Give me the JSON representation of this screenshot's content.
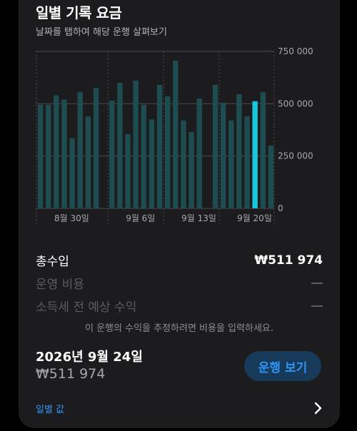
{
  "header": {
    "title": "일별 기록 요금",
    "subtitle": "날짜를 탭하여 해당 운행 살펴보기"
  },
  "chart_data": {
    "type": "bar",
    "ylim": [
      0,
      750000
    ],
    "yticks": [
      0,
      250000,
      500000,
      750000
    ],
    "ytick_labels": [
      "0",
      "250 000",
      "500 000",
      "750 000"
    ],
    "xtick_labels": [
      "8월 30일",
      "9월 6일",
      "9월 13일",
      "9월 20일"
    ],
    "grid": true,
    "selected_index": 27,
    "values": [
      495000,
      495000,
      540000,
      520000,
      335000,
      555000,
      440000,
      575000,
      0,
      515000,
      600000,
      355000,
      610000,
      495000,
      425000,
      590000,
      535000,
      705000,
      420000,
      365000,
      525000,
      0,
      590000,
      505000,
      420000,
      545000,
      440000,
      511974,
      555000,
      300000
    ],
    "colors": {
      "bar": "#1d4d50",
      "selected": "#18c8dc",
      "grid": "#4a4a4e",
      "label": "#a8a8ac"
    }
  },
  "summary": {
    "total_label": "총수입",
    "total_value": "₩511 974",
    "cost_label": "운영 비용",
    "cost_value": "—",
    "net_label": "소득세 전 예상 수익",
    "net_value": "—",
    "hint": "이 운행의 수익을 추정하려면 비용을 입력하세요."
  },
  "selection": {
    "date": "2026년 9월 24일",
    "amount": "₩511 974",
    "view_button": "운행 보기"
  },
  "footer": {
    "daily_link": "일별 값",
    "chevron_icon": "chevron-right-icon"
  }
}
